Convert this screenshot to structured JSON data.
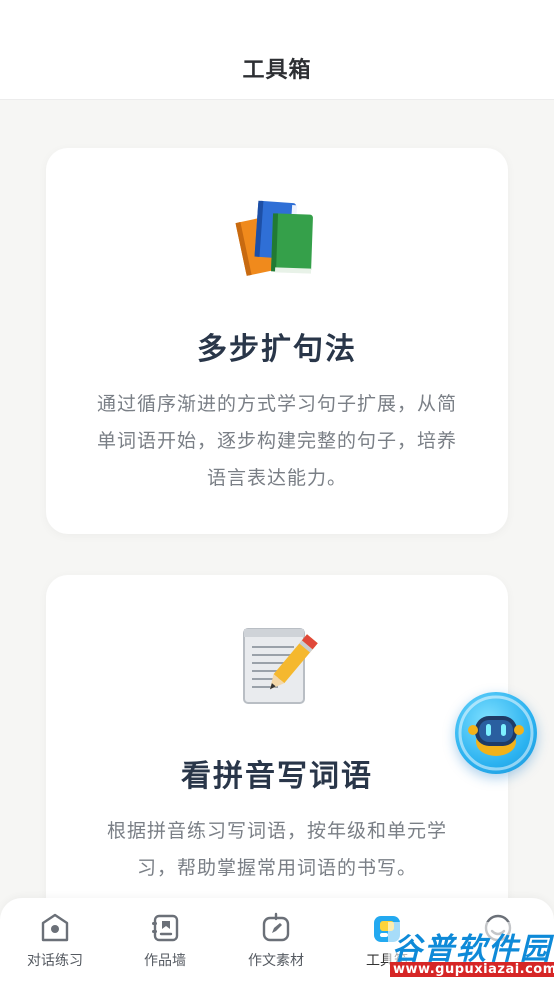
{
  "header": {
    "title": "工具箱"
  },
  "cards": [
    {
      "icon": "books-icon",
      "title": "多步扩句法",
      "desc_lines": [
        "通过循序渐进的方式学习句子扩展，从简",
        "单词语开始，逐步构建完整的句子，培养",
        "语言表达能力。"
      ]
    },
    {
      "icon": "notepad-pencil-icon",
      "title": "看拼音写词语",
      "desc_lines": [
        "根据拼音练习写词语，按年级和单元学",
        "习，帮助掌握常用词语的书写。"
      ]
    }
  ],
  "floating_button": {
    "icon": "robot-assistant-icon"
  },
  "tabbar": {
    "tabs": [
      {
        "label": "对话练习",
        "icon": "chat-practice-icon"
      },
      {
        "label": "作品墙",
        "icon": "works-wall-icon"
      },
      {
        "label": "作文素材",
        "icon": "writing-material-icon"
      },
      {
        "label": "工具箱",
        "icon": "toolbox-icon",
        "active": true
      },
      {
        "label": "",
        "icon": "profile-icon"
      }
    ]
  },
  "watermark": {
    "text": "谷普软件园",
    "url": "www.gupuxiazai.com"
  }
}
